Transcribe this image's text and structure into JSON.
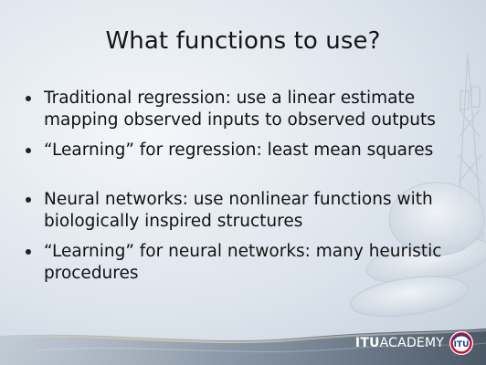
{
  "slide": {
    "title": "What functions to use?",
    "bullets": [
      {
        "line1": "Traditional regression: use a linear estimate",
        "line2": "mapping observed inputs to observed outputs"
      },
      {
        "line1": "“Learning” for regression: least mean squares",
        "line2": ""
      },
      {
        "line1": "Neural networks: use nonlinear functions with",
        "line2": "biologically inspired structures"
      },
      {
        "line1": "“Learning” for neural networks: many heuristic",
        "line2": "procedures"
      }
    ]
  },
  "footer": {
    "logo_bold": "ITU",
    "logo_rest": "ACADEMY",
    "logo_emblem_text": "ITU"
  },
  "icons": {
    "logo": "itu-emblem-icon",
    "background": "satellite-dish-icon"
  },
  "colors": {
    "banner": "#6c7a8a",
    "banner_dark": "#4b5866",
    "accent_red": "#c8102e"
  }
}
